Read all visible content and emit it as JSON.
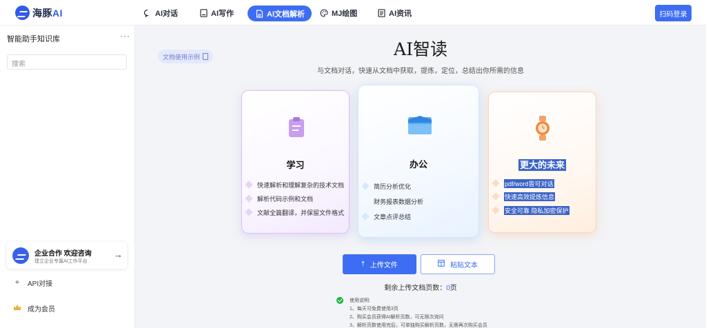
{
  "brand": {
    "name": "海豚",
    "suffix": "AI"
  },
  "nav": {
    "items": [
      {
        "label": "AI对话",
        "icon": "chat-icon"
      },
      {
        "label": "AI写作",
        "icon": "document-write-icon"
      },
      {
        "label": "AI文档解析",
        "icon": "document-parse-icon",
        "active": true
      },
      {
        "label": "MJ绘图",
        "icon": "palette-icon"
      },
      {
        "label": "AI资讯",
        "icon": "news-icon"
      }
    ],
    "login_label": "扫码登录"
  },
  "sidebar": {
    "title": "智能助手知识库",
    "more": "···",
    "search_placeholder": "搜索",
    "promo": {
      "title": "企业合作 欢迎咨询",
      "subtitle": "建立企业专属AI工作平台"
    },
    "links": [
      {
        "label": "API对接",
        "icon": "api-icon"
      },
      {
        "label": "成为会员",
        "icon": "crown-icon"
      }
    ]
  },
  "main": {
    "demo_tag": "文档使用示例",
    "title": "AI智读",
    "subtitle": "与文档对话，快速从文档中获取，提炼，定位，总结出你所需的信息",
    "cards": [
      {
        "title": "学习",
        "icon": "clipboard-icon",
        "items": [
          "快速解析和理解复杂的技术文档",
          "解析代码示例和文档",
          "文献全篇翻译，并保留文件格式"
        ]
      },
      {
        "title": "办公",
        "icon": "folder-icon",
        "items": [
          "简历分析优化",
          "财务报表数据分析",
          "文章点评总结"
        ]
      },
      {
        "title": "更大的未来",
        "icon": "watch-icon",
        "items": [
          "pdf/word皆可对话",
          "快速高效提炼信息",
          "安全可靠 隐私加密保护"
        ]
      }
    ],
    "upload_label": "上传文件",
    "paste_label": "粘贴文本",
    "remain_prefix": "剩余上传文档页数：",
    "remain_count": "0",
    "remain_suffix": "页",
    "usage": {
      "title": "使用说明:",
      "lines": [
        "1、每天可免费使用3页",
        "2、购买会员获得AI解析页数，可无限次询问",
        "3、解析页数使用完后，可单独购买解析页数，无需再次购买会员"
      ]
    }
  },
  "colors": {
    "accent": "#3d6df2",
    "study_border": "#d9c3f2",
    "office_border": "#d4e6fb",
    "future_border": "#fbd5b8",
    "ok_green": "#1cb33d"
  }
}
